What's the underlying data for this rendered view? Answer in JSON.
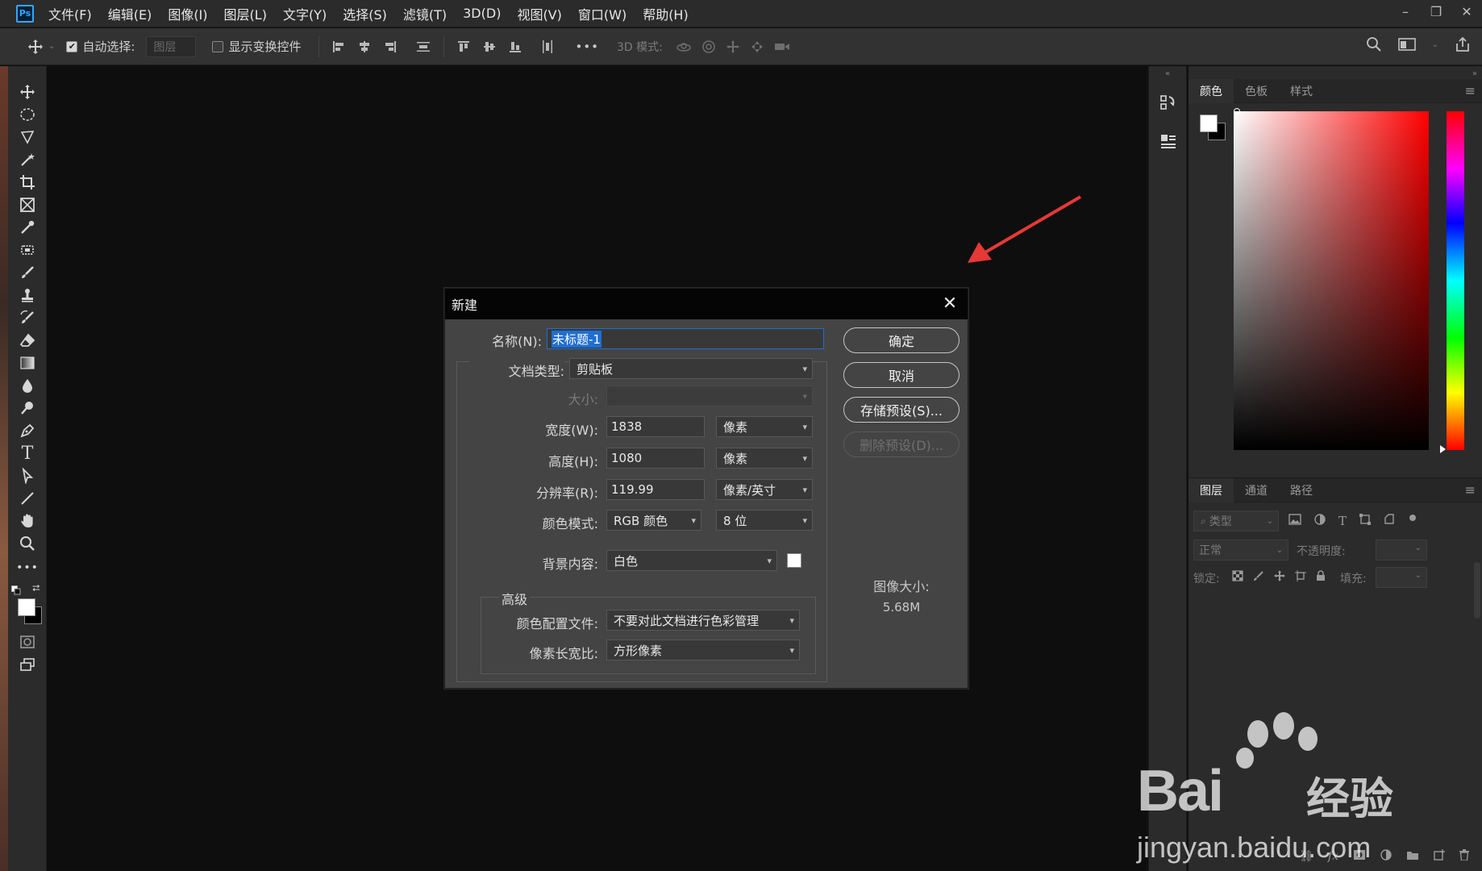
{
  "app": {
    "logo": "Ps"
  },
  "menu": [
    "文件(F)",
    "编辑(E)",
    "图像(I)",
    "图层(L)",
    "文字(Y)",
    "选择(S)",
    "滤镜(T)",
    "3D(D)",
    "视图(V)",
    "窗口(W)",
    "帮助(H)"
  ],
  "window_controls": {
    "minimize": "–",
    "restore": "❐",
    "close": "✕"
  },
  "options": {
    "auto_select_label": "自动选择:",
    "auto_select_checked": true,
    "layer_select": "图层",
    "show_transform_label": "显示变换控件",
    "more": "•••",
    "mode_3d_label": "3D 模式:"
  },
  "color_panel": {
    "tabs": [
      "颜色",
      "色板",
      "样式"
    ],
    "active": "颜色"
  },
  "layers_panel": {
    "tabs": [
      "图层",
      "通道",
      "路径"
    ],
    "active": "图层",
    "search_placeholder": "类型",
    "blend_mode": "正常",
    "opacity_label": "不透明度:",
    "lock_label": "锁定:",
    "fill_label": "填充:"
  },
  "dialog": {
    "title": "新建",
    "name_label": "名称(N):",
    "name_value": "未标题-1",
    "doc_type_label": "文档类型:",
    "doc_type_value": "剪贴板",
    "size_label": "大小:",
    "width_label": "宽度(W):",
    "width_value": "1838",
    "width_unit": "像素",
    "height_label": "高度(H):",
    "height_value": "1080",
    "height_unit": "像素",
    "resolution_label": "分辨率(R):",
    "resolution_value": "119.99",
    "resolution_unit": "像素/英寸",
    "color_mode_label": "颜色模式:",
    "color_mode_value": "RGB 颜色",
    "bit_depth_value": "8 位",
    "background_label": "背景内容:",
    "background_value": "白色",
    "advanced_label": "高级",
    "color_profile_label": "颜色配置文件:",
    "color_profile_value": "不要对此文档进行色彩管理",
    "pixel_aspect_label": "像素长宽比:",
    "pixel_aspect_value": "方形像素",
    "ok_button": "确定",
    "cancel_button": "取消",
    "save_preset_button": "存储预设(S)...",
    "delete_preset_button": "删除预设(D)...",
    "image_size_label": "图像大小:",
    "image_size_value": "5.68M"
  },
  "watermark": {
    "brand": "Bai",
    "brand_cn": "经验",
    "url": "jingyan.baidu.com"
  },
  "colors": {
    "accent_blue": "#31a8ff",
    "arrow_red": "#e53935",
    "selection_blue": "#1f6fd1"
  }
}
